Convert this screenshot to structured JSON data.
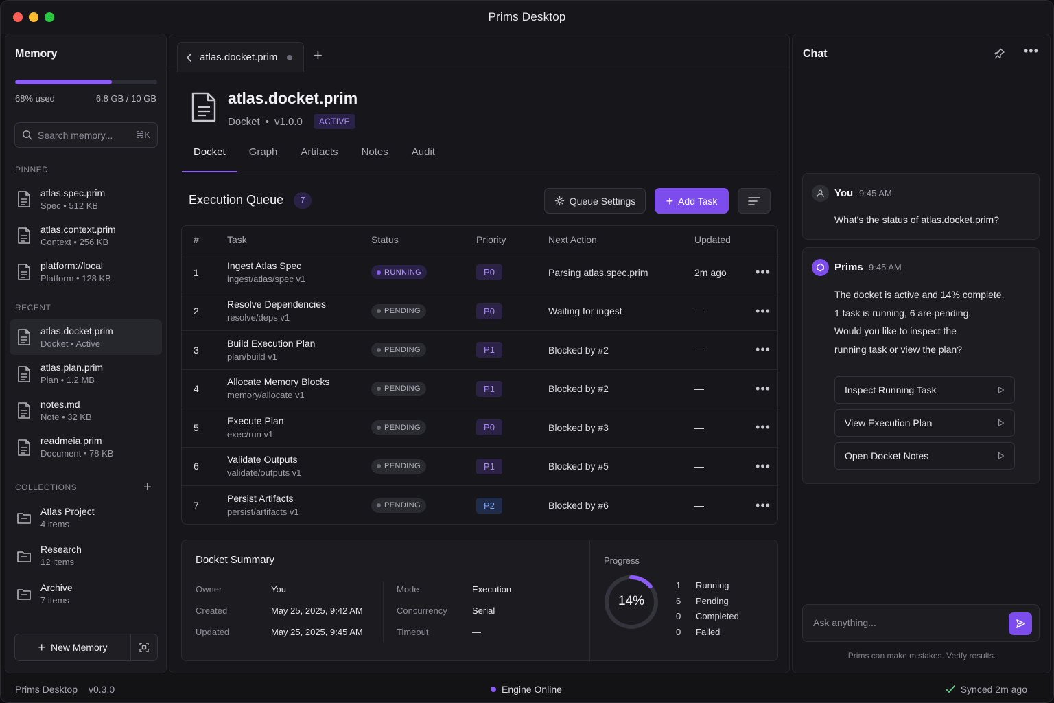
{
  "window": {
    "title": "Prims Desktop"
  },
  "sidebar": {
    "title": "Memory",
    "memory": {
      "used_label": "68% used",
      "total_label": "6.8 GB / 10 GB",
      "used_fraction": 0.68
    },
    "search": {
      "placeholder": "Search memory...",
      "shortcut": "⌘K"
    },
    "pinned_label": "PINNED",
    "pinned": [
      {
        "name": "atlas.spec.prim",
        "meta": "Spec • 512 KB"
      },
      {
        "name": "atlas.context.prim",
        "meta": "Context • 256 KB"
      },
      {
        "name": "platform://local",
        "meta": "Platform • 128 KB"
      }
    ],
    "recent_label": "RECENT",
    "recent": [
      {
        "name": "atlas.docket.prim",
        "meta": "Docket • Active"
      },
      {
        "name": "atlas.plan.prim",
        "meta": "Plan • 1.2 MB"
      },
      {
        "name": "notes.md",
        "meta": "Note • 32 KB"
      },
      {
        "name": "readmeia.prim",
        "meta": "Document • 78 KB"
      }
    ],
    "collections_label": "COLLECTIONS",
    "collections": [
      {
        "name": "Atlas Project",
        "meta": "4 items"
      },
      {
        "name": "Research",
        "meta": "12 items"
      },
      {
        "name": "Archive",
        "meta": "7 items"
      }
    ],
    "new_memory_label": "New Memory"
  },
  "main": {
    "tab_name": "atlas.docket.prim",
    "doc": {
      "title": "atlas.docket.prim",
      "type": "Docket",
      "version": "v1.0.0",
      "status": "ACTIVE"
    },
    "subtabs": [
      "Docket",
      "Graph",
      "Artifacts",
      "Notes",
      "Audit"
    ],
    "queue": {
      "title": "Execution Queue",
      "count": "7",
      "settings_label": "Queue Settings",
      "add_label": "Add Task",
      "columns": [
        "#",
        "Task",
        "Status",
        "Priority",
        "Next Action",
        "Updated"
      ],
      "rows": [
        {
          "num": "1",
          "task": "Ingest Atlas Spec",
          "sub": "ingest/atlas/spec v1",
          "status": "RUNNING",
          "priority": "P0",
          "next": "Parsing atlas.spec.prim",
          "updated": "2m ago"
        },
        {
          "num": "2",
          "task": "Resolve Dependencies",
          "sub": "resolve/deps v1",
          "status": "PENDING",
          "priority": "P0",
          "next": "Waiting for ingest",
          "updated": "—"
        },
        {
          "num": "3",
          "task": "Build Execution Plan",
          "sub": "plan/build v1",
          "status": "PENDING",
          "priority": "P1",
          "next": "Blocked by #2",
          "updated": "—"
        },
        {
          "num": "4",
          "task": "Allocate Memory Blocks",
          "sub": "memory/allocate v1",
          "status": "PENDING",
          "priority": "P1",
          "next": "Blocked by #2",
          "updated": "—"
        },
        {
          "num": "5",
          "task": "Execute Plan",
          "sub": "exec/run v1",
          "status": "PENDING",
          "priority": "P0",
          "next": "Blocked by #3",
          "updated": "—"
        },
        {
          "num": "6",
          "task": "Validate Outputs",
          "sub": "validate/outputs v1",
          "status": "PENDING",
          "priority": "P1",
          "next": "Blocked by #5",
          "updated": "—"
        },
        {
          "num": "7",
          "task": "Persist Artifacts",
          "sub": "persist/artifacts v1",
          "status": "PENDING",
          "priority": "P2",
          "next": "Blocked by #6",
          "updated": "—"
        }
      ]
    },
    "summary": {
      "title": "Docket Summary",
      "owner_k": "Owner",
      "owner_v": "You",
      "created_k": "Created",
      "created_v": "May 25, 2025, 9:42 AM",
      "updated_k": "Updated",
      "updated_v": "May 25, 2025, 9:45 AM",
      "mode_k": "Mode",
      "mode_v": "Execution",
      "concurrency_k": "Concurrency",
      "concurrency_v": "Serial",
      "timeout_k": "Timeout",
      "timeout_v": "—",
      "progress_label": "Progress",
      "progress_text": "14%",
      "progress_fraction": 0.14,
      "stats": [
        {
          "n": "1",
          "label": "Running"
        },
        {
          "n": "6",
          "label": "Pending"
        },
        {
          "n": "0",
          "label": "Completed"
        },
        {
          "n": "0",
          "label": "Failed"
        }
      ]
    }
  },
  "chat": {
    "title": "Chat",
    "user_msg": {
      "name": "You",
      "time": "9:45 AM",
      "text": "What's the status of atlas.docket.prim?"
    },
    "bot_msg": {
      "name": "Prims",
      "time": "9:45 AM",
      "lines": [
        "The docket is active and 14% complete.",
        "1 task is running, 6 are pending.",
        "Would you like to inspect the",
        "running task or view the plan?"
      ],
      "actions": [
        "Inspect Running Task",
        "View Execution Plan",
        "Open Docket Notes"
      ]
    },
    "input_placeholder": "Ask anything...",
    "disclaimer": "Prims can make mistakes. Verify results."
  },
  "statusbar": {
    "app": "Prims Desktop",
    "version": "v0.3.0",
    "engine": "Engine Online",
    "sync": "Synced 2m ago"
  },
  "colors": {
    "accent": "#8b5cf6",
    "button": "#7c4dec",
    "background": "#131316"
  }
}
